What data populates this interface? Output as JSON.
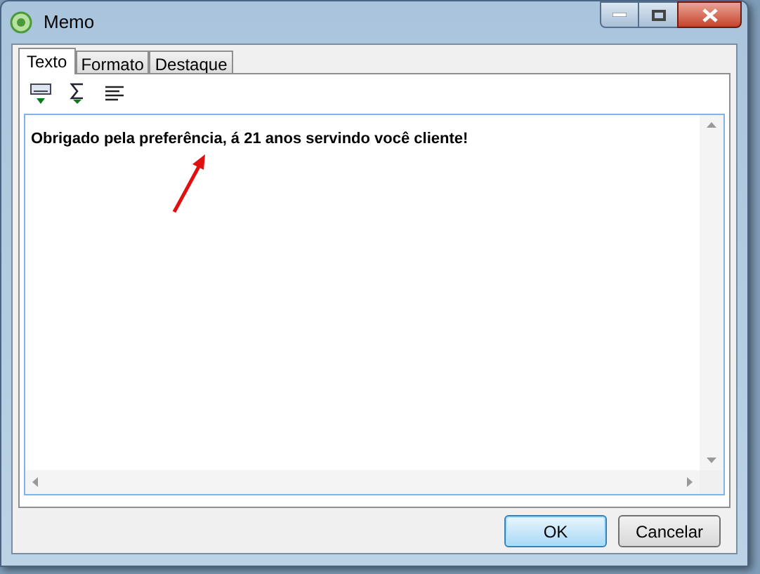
{
  "window": {
    "title": "Memo"
  },
  "tabs": [
    {
      "label": "Texto",
      "selected": true
    },
    {
      "label": "Formato",
      "selected": false
    },
    {
      "label": "Destaque",
      "selected": false
    }
  ],
  "memo": {
    "value": "Obrigado pela preferência, á 21 anos servindo você cliente!"
  },
  "buttons": [
    {
      "label": "OK",
      "default": true
    },
    {
      "label": "Cancelar",
      "default": false
    }
  ]
}
